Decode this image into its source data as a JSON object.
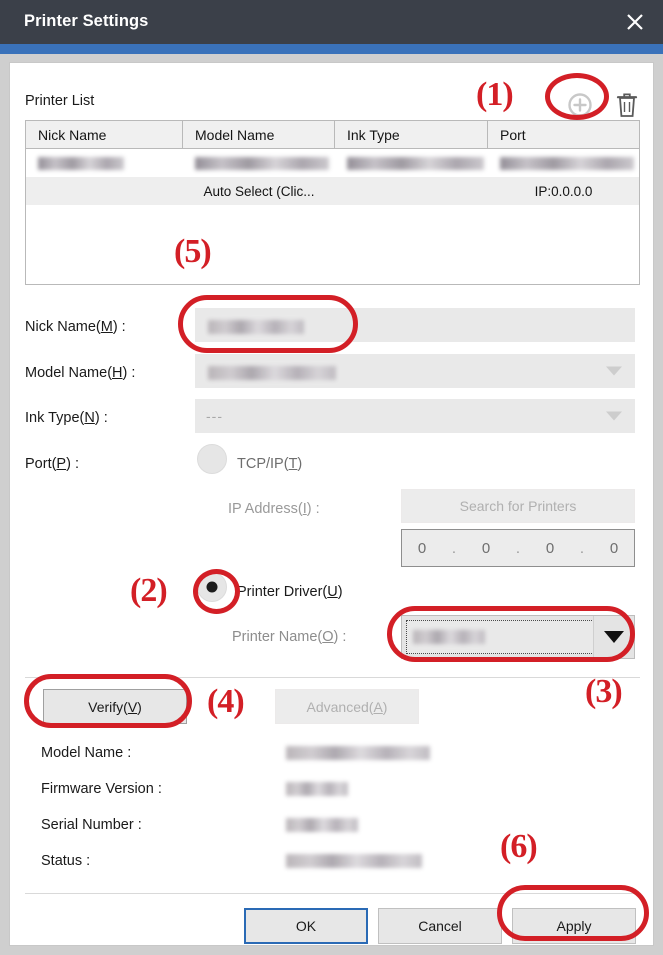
{
  "window": {
    "title": "Printer Settings",
    "close_icon": "close-icon",
    "accent_color": "#3a72ba",
    "titlebar_color": "#3b4049"
  },
  "printer_list": {
    "label": "Printer List",
    "add_icon": "add-circle-icon",
    "delete_icon": "trash-icon",
    "columns": [
      "Nick Name",
      "Model Name",
      "Ink Type",
      "Port"
    ],
    "rows": [
      {
        "nick_name": "",
        "model_name": "",
        "ink_type": "",
        "port": "",
        "redacted": true
      },
      {
        "nick_name": "",
        "model_name": "Auto Select (Clic...",
        "ink_type": "",
        "port": "IP:0.0.0.0",
        "redacted": false
      }
    ]
  },
  "form": {
    "nick_name": {
      "label_main": "Nick Name(",
      "label_mnemonic": "M",
      "label_tail": ") :",
      "value": ""
    },
    "model_name": {
      "label_main": "Model Name(",
      "label_mnemonic": "H",
      "label_tail": ") :",
      "value": ""
    },
    "ink_type": {
      "label_main": "Ink Type(",
      "label_mnemonic": "N",
      "label_tail": ") :",
      "value": "---"
    },
    "port": {
      "label_main": "Port(",
      "label_mnemonic": "P",
      "label_tail": ") :"
    },
    "tcpip_radio": {
      "label_main": "TCP/IP(",
      "label_mnemonic": "T",
      "label_tail": ")",
      "selected": false
    },
    "ip_address": {
      "label_main": "IP Address(",
      "label_mnemonic": "I",
      "label_tail": ") :",
      "octets": [
        "0",
        "0",
        "0",
        "0"
      ],
      "separator": "."
    },
    "search_button": {
      "label": "Search for Printers",
      "enabled": false
    },
    "printer_driver_radio": {
      "label_main": "Printer Driver(",
      "label_mnemonic": "U",
      "label_tail": ")",
      "selected": true
    },
    "printer_name": {
      "label_main": "Printer Name(",
      "label_mnemonic": "O",
      "label_tail": ") :",
      "value": ""
    },
    "verify_button": {
      "label_main": "Verify(",
      "label_mnemonic": "V",
      "label_tail": ")",
      "enabled": true
    },
    "advanced_button": {
      "label_main": "Advanced(",
      "label_mnemonic": "A",
      "label_tail": ")",
      "enabled": false
    }
  },
  "info": {
    "model_name_label": "Model Name :",
    "firmware_version_label": "Firmware Version :",
    "serial_number_label": "Serial Number :",
    "status_label": "Status :",
    "model_name_value": "",
    "firmware_version_value": "",
    "serial_number_value": "",
    "status_value": ""
  },
  "footer": {
    "ok": "OK",
    "cancel": "Cancel",
    "apply": "Apply"
  },
  "annotations": {
    "a1": "(1)",
    "a2": "(2)",
    "a3": "(3)",
    "a4": "(4)",
    "a5": "(5)",
    "a6": "(6)",
    "color": "#d31f26"
  }
}
